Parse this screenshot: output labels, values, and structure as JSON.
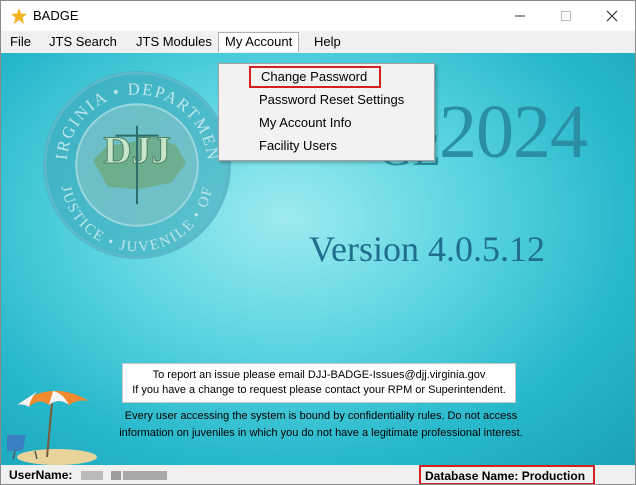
{
  "window": {
    "title": "BADGE",
    "icon": "badge-app-icon",
    "controls": [
      "minimize-icon",
      "maximize-icon",
      "close-icon"
    ]
  },
  "menubar": {
    "items": [
      {
        "label": "File"
      },
      {
        "label": "JTS Search"
      },
      {
        "label": "JTS Modules"
      },
      {
        "label": "My Account"
      },
      {
        "label": "Help"
      }
    ]
  },
  "dropdown": {
    "parent": "My Account",
    "items": [
      {
        "label": "Change Password"
      },
      {
        "label": "Password Reset Settings"
      },
      {
        "label": "My Account Info"
      },
      {
        "label": "Facility Users"
      }
    ]
  },
  "splash": {
    "badge_mid": "GE",
    "year": "2024",
    "version": "Version 4.0.5.12",
    "notice_line1": "To report an issue please email DJJ-BADGE-Issues@djj.virginia.gov",
    "notice_line2": "If you have a change to request please contact your RPM or Superintendent.",
    "confidentiality_line1": "Every user accessing the system is bound by confidentiality rules. Do not access",
    "confidentiality_line2": "information on juveniles in which you do not have a legitimate professional interest.",
    "seal": {
      "top_text": "VIRGINIA • DEPARTMENT",
      "bottom_text": "JUSTICE • JUVENILE • OF",
      "center": "DJJ"
    }
  },
  "statusbar": {
    "username_label": "UserName:",
    "database_label": "Database Name:  Production"
  },
  "colors": {
    "highlight_box": "#d32020",
    "background_teal": "#27b8cb",
    "version_text": "#1f6e8e"
  }
}
